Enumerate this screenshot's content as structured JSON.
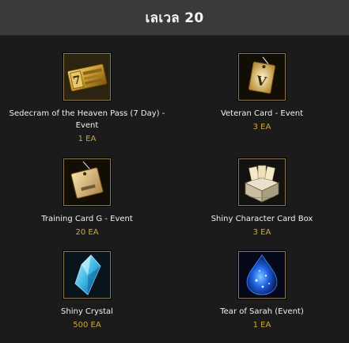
{
  "header": {
    "title": "เลเวล 20"
  },
  "items": [
    {
      "name_line1": "Sedecram of the Heaven Pass (7 Day) -",
      "name_line2": "Event",
      "qty": "1 EA",
      "icon": "golden-pass-ticket-icon"
    },
    {
      "name_line1": "Veteran Card - Event",
      "name_line2": "",
      "qty": "3 EA",
      "icon": "veteran-card-icon"
    },
    {
      "name_line1": "Training Card G - Event",
      "name_line2": "",
      "qty": "20 EA",
      "icon": "training-card-icon"
    },
    {
      "name_line1": "Shiny Character Card Box",
      "name_line2": "",
      "qty": "3 EA",
      "icon": "card-box-icon"
    },
    {
      "name_line1": "Shiny Crystal",
      "name_line2": "",
      "qty": "500 EA",
      "icon": "blue-crystal-icon"
    },
    {
      "name_line1": "Tear of Sarah (Event)",
      "name_line2": "",
      "qty": "1 EA",
      "icon": "blue-tear-gem-icon"
    }
  ],
  "colors": {
    "background": "#1b1b1b",
    "header": "#3a3a3a",
    "quantity": "#d2a63c",
    "icon_border": "#8b7a55"
  }
}
